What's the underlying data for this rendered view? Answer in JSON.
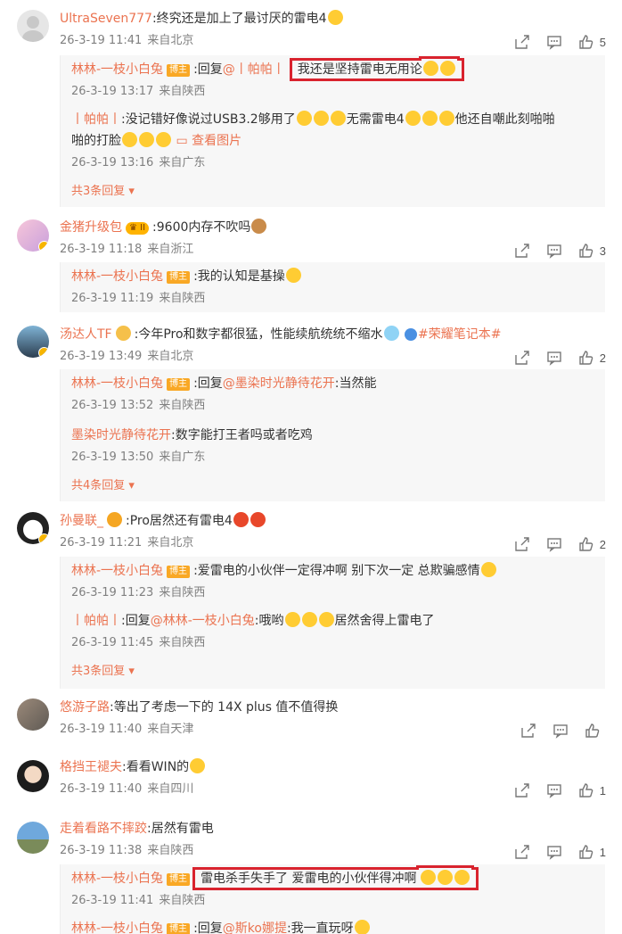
{
  "comments": [
    {
      "name": "UltraSeven777",
      "text": ":终究还是加上了最讨厌的雷电4",
      "time": "26-3-19 11:41",
      "loc": "来自北京",
      "likes": "5",
      "replies": [
        {
          "name": "林林-一枝小白兔",
          "badge": "博主",
          "pre": ":回复",
          "mention": "@丨帕帕丨",
          "text": "我还是坚持雷电无用论",
          "time": "26-3-19 13:17",
          "loc": "来自陕西"
        },
        {
          "name": "丨帕帕丨",
          "text": ":没记错好像说过USB3.2够用了",
          "text2": "无需雷电4",
          "text3": "他还自嘲",
          "text4": "此刻啪啪",
          "text5": "啪的打脸",
          "img": "查看图片",
          "time": "26-3-19 13:16",
          "loc": "来自广东"
        }
      ],
      "more": "共3条回复"
    },
    {
      "name": "金猪升级包",
      "text": ":9600内存不吹吗",
      "time": "26-3-19 11:18",
      "loc": "来自浙江",
      "likes": "3",
      "replies": [
        {
          "name": "林林-一枝小白兔",
          "badge": "博主",
          "text": ":我的认知是基操",
          "time": "26-3-19 11:19",
          "loc": "来自陕西"
        }
      ]
    },
    {
      "name": "汤达人TF",
      "text": ":今年Pro和数字都很猛，性能续航统统不缩水",
      "topic": "#荣耀笔记本#",
      "time": "26-3-19 13:49",
      "loc": "来自北京",
      "likes": "2",
      "replies": [
        {
          "name": "林林-一枝小白兔",
          "badge": "博主",
          "pre": ":回复",
          "mention": "@墨染时光静待花开",
          "text": ":当然能",
          "time": "26-3-19 13:52",
          "loc": "来自陕西"
        },
        {
          "name": "墨染时光静待花开",
          "text": ":数字能打王者吗或者吃鸡",
          "time": "26-3-19 13:50",
          "loc": "来自广东"
        }
      ],
      "more": "共4条回复"
    },
    {
      "name": "孙曼联_",
      "text": ":Pro居然还有雷电4",
      "time": "26-3-19 11:21",
      "loc": "来自北京",
      "likes": "2",
      "replies": [
        {
          "name": "林林-一枝小白兔",
          "badge": "博主",
          "text": ":爱雷电的小伙伴一定得冲啊 别下次一定 总欺骗感情",
          "time": "26-3-19 11:23",
          "loc": "来自陕西"
        },
        {
          "name": "丨帕帕丨",
          "pre": ":回复",
          "mention": "@林林-一枝小白兔",
          "text": ":哦哟",
          "text2": "居然舍得上雷电了",
          "time": "26-3-19 11:45",
          "loc": "来自陕西"
        }
      ],
      "more": "共3条回复"
    },
    {
      "name": "悠游子路",
      "text": ":等出了考虑一下的 14X plus 值不值得换",
      "time": "26-3-19 11:40",
      "loc": "来自天津",
      "likes": ""
    },
    {
      "name": "格挡王褪夫",
      "text": ":看看WIN的",
      "time": "26-3-19 11:40",
      "loc": "来自四川",
      "likes": "1"
    },
    {
      "name": "走着看路不摔跤",
      "text": ":居然有雷电",
      "time": "26-3-19 11:38",
      "loc": "来自陕西",
      "likes": "1",
      "replies": [
        {
          "name": "林林-一枝小白兔",
          "badge": "博主",
          "text": "雷电杀手失手了 爱雷电的小伙伴得冲啊",
          "time": "26-3-19 11:41",
          "loc": "来自陕西"
        },
        {
          "name": "林林-一枝小白兔",
          "badge": "博主",
          "pre": ":回复",
          "mention": "@斯ko娜提",
          "text": ":我一直玩呀",
          "time": "",
          "loc": ""
        }
      ]
    }
  ],
  "colors": {
    "name": "#eb7350",
    "highlight": "#d9232e",
    "bg_reply": "#f7f7f7"
  }
}
